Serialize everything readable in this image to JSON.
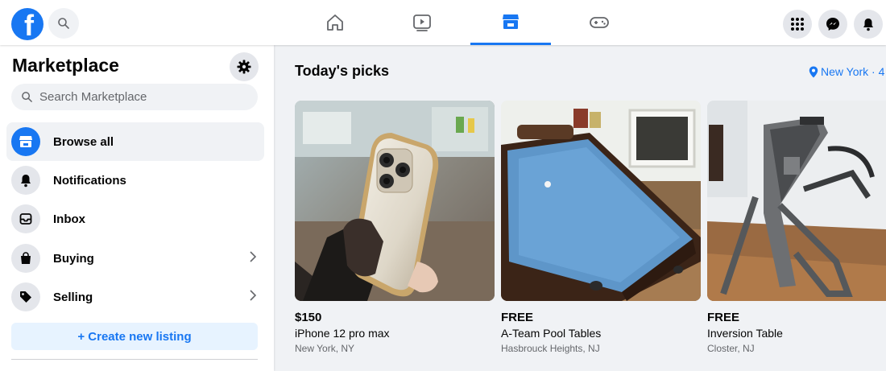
{
  "topbar": {
    "logo_letter": "f",
    "nav_tabs": [
      {
        "name": "home",
        "active": false
      },
      {
        "name": "watch",
        "active": false
      },
      {
        "name": "marketplace",
        "active": true
      },
      {
        "name": "gaming",
        "active": false
      }
    ],
    "right_buttons": [
      "menu-grid-icon",
      "messenger-icon",
      "notifications-bell-icon"
    ],
    "accent_color": "#1877f2"
  },
  "sidebar": {
    "title": "Marketplace",
    "search_placeholder": "Search Marketplace",
    "items": [
      {
        "label": "Browse all",
        "icon": "storefront-icon",
        "active": true
      },
      {
        "label": "Notifications",
        "icon": "bell-icon",
        "active": false
      },
      {
        "label": "Inbox",
        "icon": "inbox-icon",
        "active": false
      },
      {
        "label": "Buying",
        "icon": "shopping-bag-icon",
        "active": false,
        "has_chevron": true
      },
      {
        "label": "Selling",
        "icon": "tag-icon",
        "active": false,
        "has_chevron": true
      }
    ],
    "create_listing_label": "+ Create new listing"
  },
  "main": {
    "title": "Today's picks",
    "location": "New York · 4",
    "listings": [
      {
        "price": "$150",
        "title": "iPhone 12 pro max",
        "location": "New York, NY"
      },
      {
        "price": "FREE",
        "title": "A-Team Pool Tables",
        "location": "Hasbrouck Heights, NJ"
      },
      {
        "price": "FREE",
        "title": "Inversion Table",
        "location": "Closter, NJ"
      }
    ]
  }
}
